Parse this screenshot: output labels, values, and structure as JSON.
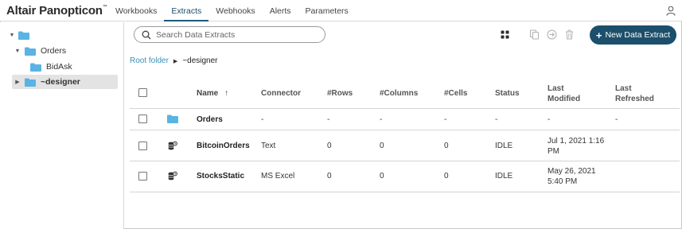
{
  "app": {
    "brand": "Altair Panopticon",
    "trademark": "™"
  },
  "nav": {
    "tabs": [
      {
        "label": "Workbooks",
        "active": false
      },
      {
        "label": "Extracts",
        "active": true
      },
      {
        "label": "Webhooks",
        "active": false
      },
      {
        "label": "Alerts",
        "active": false
      },
      {
        "label": "Parameters",
        "active": false
      }
    ]
  },
  "sidebar": {
    "tree": [
      {
        "label": "",
        "level": 0,
        "expanded": true,
        "selected": false
      },
      {
        "label": "Orders",
        "level": 1,
        "expanded": true,
        "selected": false
      },
      {
        "label": "BidAsk",
        "level": 2,
        "expanded": false,
        "selected": false
      },
      {
        "label": "~designer",
        "level": 1,
        "expanded": false,
        "selected": true
      }
    ]
  },
  "toolbar": {
    "search_placeholder": "Search Data Extracts",
    "search_value": "",
    "new_button_label": "New Data Extract"
  },
  "breadcrumb": {
    "root": "Root folder",
    "current": "~designer"
  },
  "table": {
    "headers": {
      "name": "Name",
      "connector": "Connector",
      "rows": "#Rows",
      "columns": "#Columns",
      "cells": "#Cells",
      "status": "Status",
      "last_modified_1": "Last",
      "last_modified_2": "Modified",
      "last_refreshed_1": "Last",
      "last_refreshed_2": "Refreshed"
    },
    "sort_indicator": "↑",
    "rows": [
      {
        "type": "folder",
        "name": "Orders",
        "connector": "-",
        "rows": "-",
        "columns": "-",
        "cells": "-",
        "status": "-",
        "modified_1": "-",
        "modified_2": "",
        "refreshed": "-"
      },
      {
        "type": "extract",
        "name": "BitcoinOrders",
        "connector": "Text",
        "rows": "0",
        "columns": "0",
        "cells": "0",
        "status": "IDLE",
        "modified_1": "Jul 1, 2021 1:16",
        "modified_2": "PM",
        "refreshed": ""
      },
      {
        "type": "extract",
        "name": "StocksStatic",
        "connector": "MS Excel",
        "rows": "0",
        "columns": "0",
        "cells": "0",
        "status": "IDLE",
        "modified_1": "May 26, 2021",
        "modified_2": "5:40 PM",
        "refreshed": ""
      }
    ]
  },
  "colors": {
    "accent": "#1c4f6b",
    "folder": "#5ab3e3",
    "link": "#3a8fb5"
  },
  "icons": [
    "user-icon",
    "search-icon",
    "grid-view-icon",
    "copy-icon",
    "move-icon",
    "trash-icon",
    "folder-icon",
    "database-icon",
    "caret-down-icon",
    "caret-right-icon"
  ]
}
